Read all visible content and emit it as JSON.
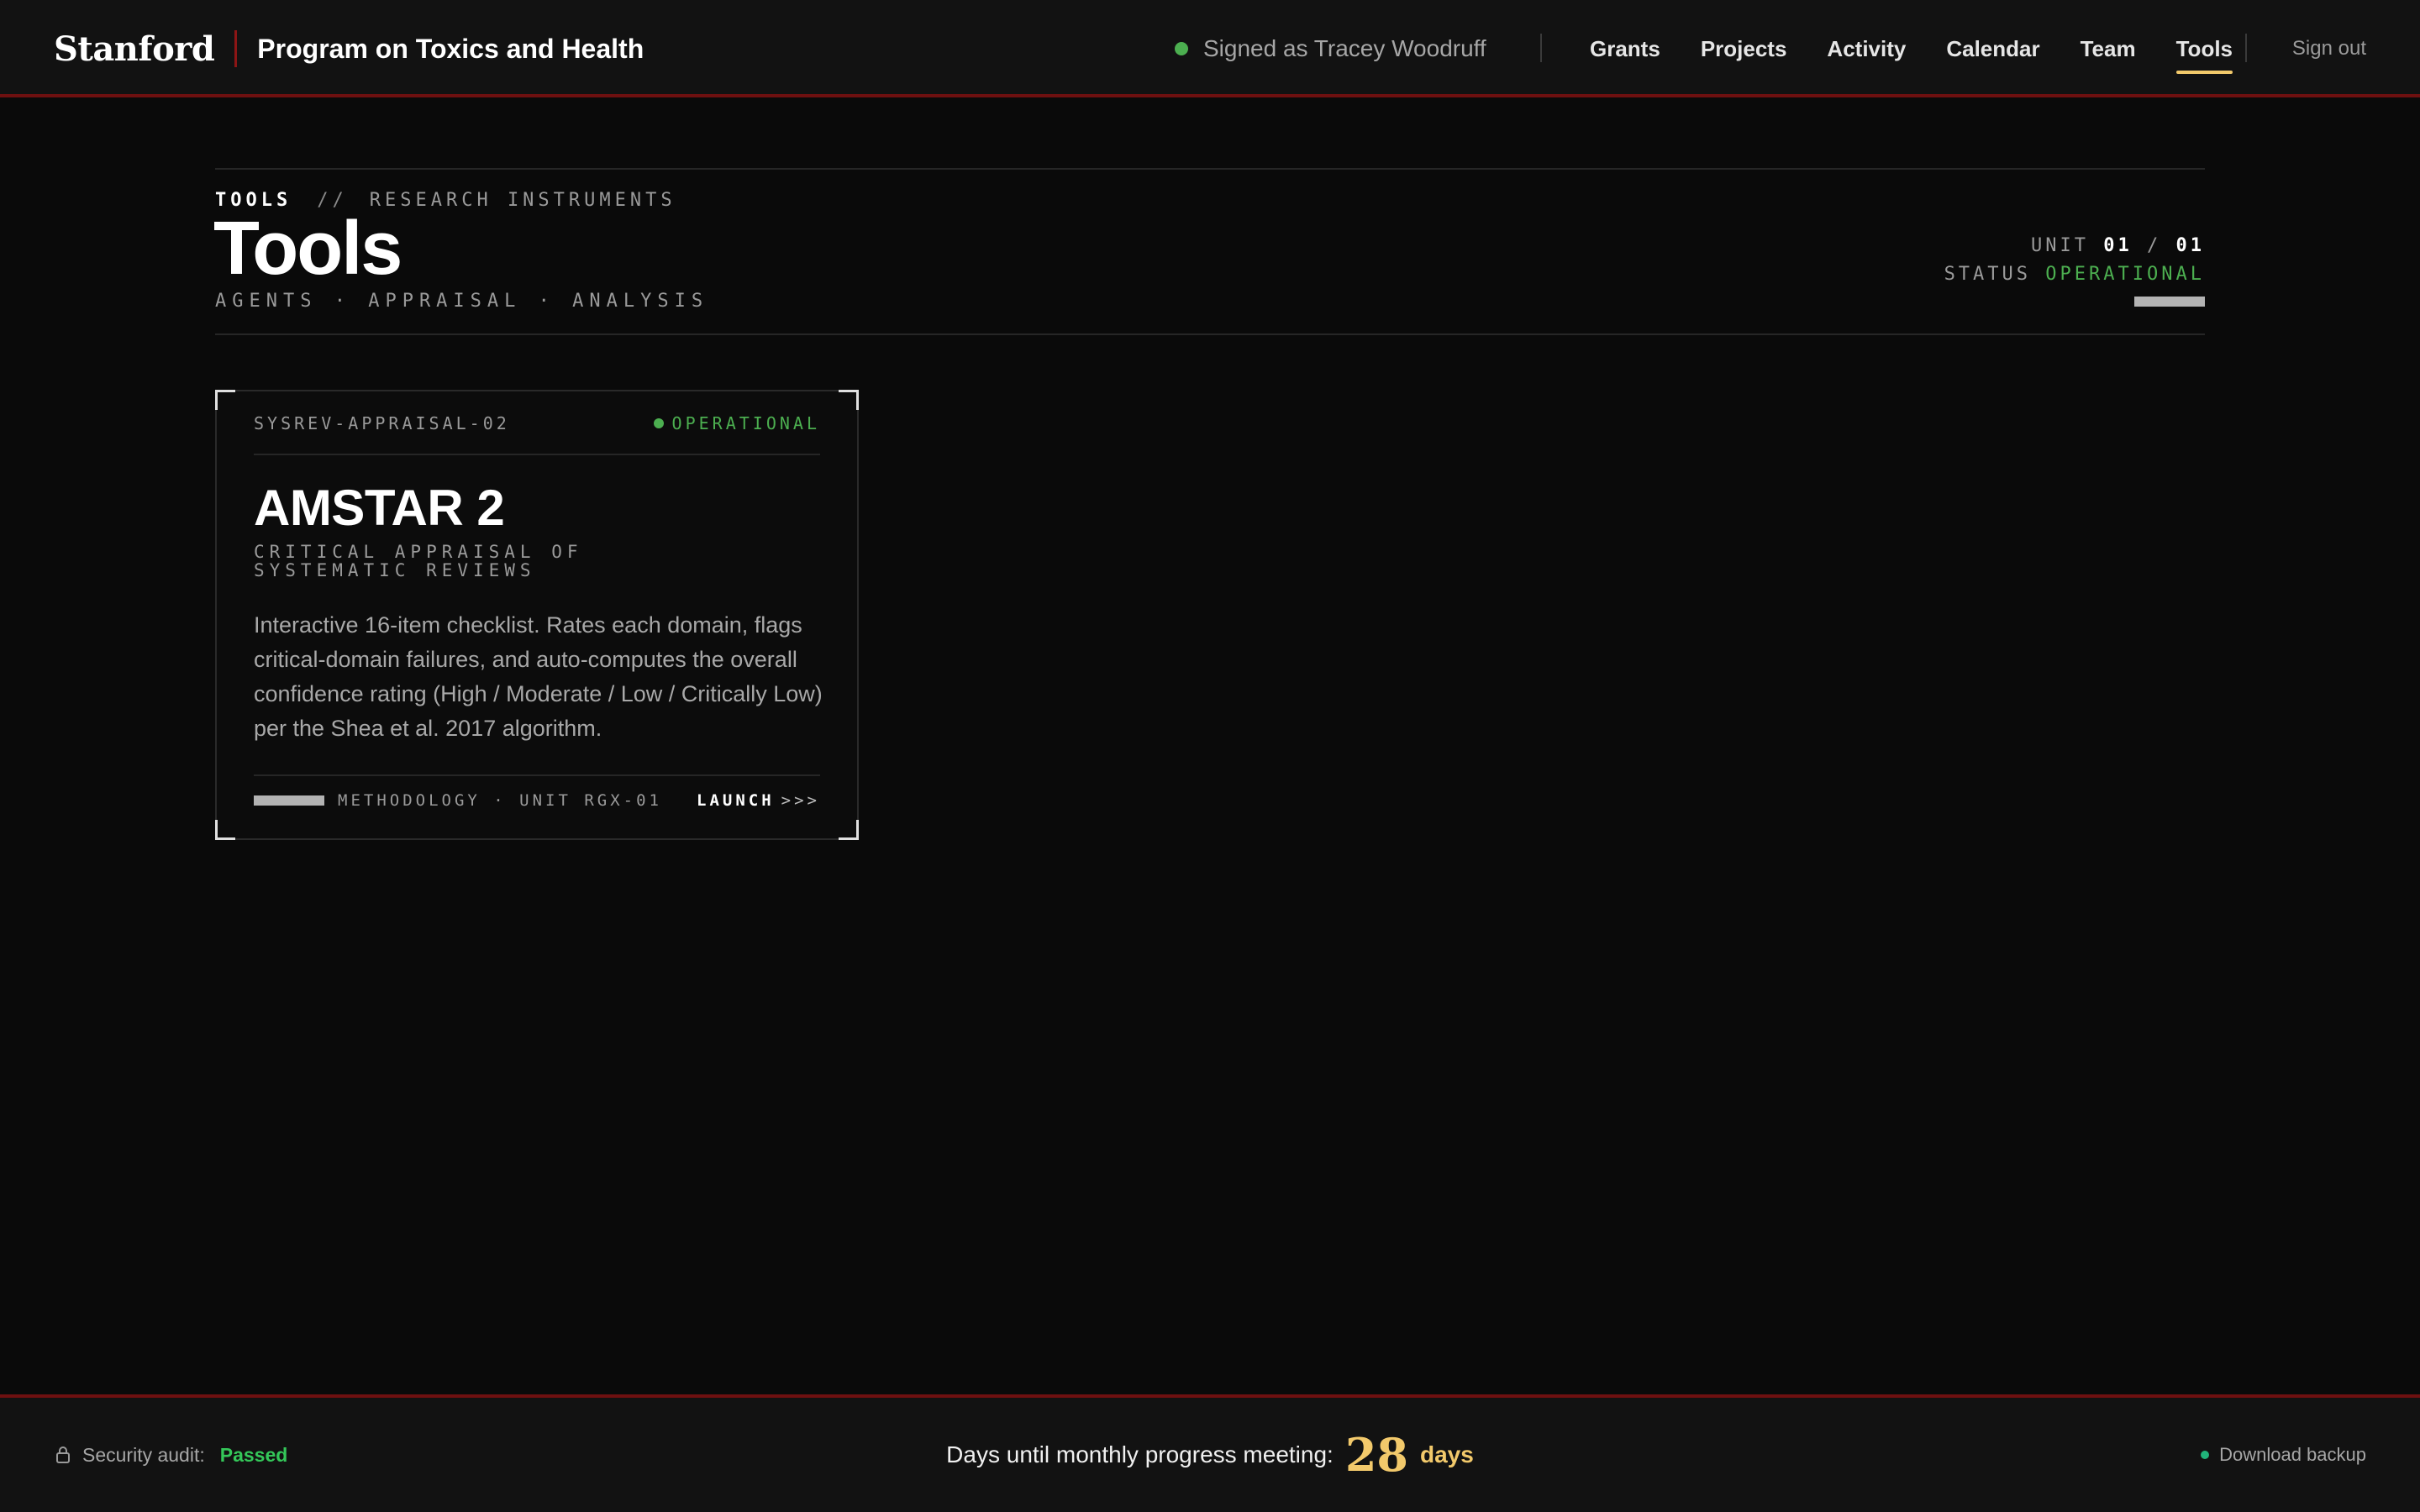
{
  "header": {
    "brand": "Stanford",
    "program": "Program on Toxics and Health",
    "session_text": "Signed as Tracey Woodruff",
    "nav": [
      {
        "label": "Grants",
        "active": false
      },
      {
        "label": "Projects",
        "active": false
      },
      {
        "label": "Activity",
        "active": false
      },
      {
        "label": "Calendar",
        "active": false
      },
      {
        "label": "Team",
        "active": false
      },
      {
        "label": "Tools",
        "active": true
      }
    ],
    "sign_out": "Sign out",
    "accent_color": "#f2c96b",
    "border_color": "#6e1010"
  },
  "page": {
    "breadcrumb_current": "TOOLS",
    "breadcrumb_sep": "//",
    "breadcrumb_section": "RESEARCH INSTRUMENTS",
    "title": "Tools",
    "subtitle": "AGENTS · APPRAISAL · ANALYSIS",
    "unit_label": "UNIT",
    "unit_current": "01",
    "unit_sep": "/",
    "unit_total": "01",
    "status_label": "STATUS",
    "status_value": "OPERATIONAL"
  },
  "tools": [
    {
      "code": "SYSREV-APPRAISAL-02",
      "status": "OPERATIONAL",
      "status_color": "#4caf50",
      "name": "AMSTAR 2",
      "kicker": "CRITICAL APPRAISAL OF SYSTEMATIC REVIEWS",
      "description": "Interactive 16-item checklist. Rates each domain, flags critical-domain failures, and auto-computes the overall confidence rating (High / Moderate / Low / Critically Low) per the Shea et al. 2017 algorithm.",
      "footer_meta": "METHODOLOGY · UNIT RGX-01",
      "launch_label": "LAUNCH",
      "launch_arrows": ">>>"
    }
  ],
  "footer": {
    "audit_label": "Security audit:",
    "audit_value": "Passed",
    "countdown_label": "Days until monthly progress meeting:",
    "countdown_value": "28",
    "countdown_unit": "days",
    "backup_label": "Download backup"
  }
}
